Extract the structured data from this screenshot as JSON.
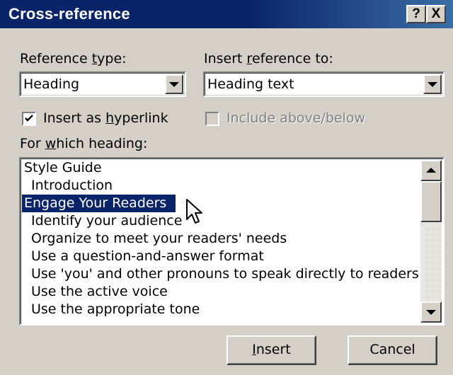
{
  "window": {
    "title": "Cross-reference",
    "help_label": "?",
    "close_label": "X"
  },
  "reference_type": {
    "label_before": "Reference ",
    "label_accel": "t",
    "label_after": "ype:",
    "value": "Heading"
  },
  "insert_reference": {
    "label_before": "Insert ",
    "label_accel": "r",
    "label_after": "eference to:",
    "value": "Heading text"
  },
  "hyperlink": {
    "label_before": "Insert as ",
    "label_accel": "h",
    "label_after": "yperlink",
    "checked": true
  },
  "above_below": {
    "label": "Include above/below",
    "enabled": false
  },
  "which_heading": {
    "label_before": "For ",
    "label_accel": "w",
    "label_after": "hich heading:"
  },
  "headings": [
    {
      "text": "Style Guide",
      "level": 1,
      "selected": false
    },
    {
      "text": "Introduction",
      "level": 2,
      "selected": false
    },
    {
      "text": "Engage Your Readers",
      "level": 1,
      "selected": true
    },
    {
      "text": "Identify your audience",
      "level": 2,
      "selected": false
    },
    {
      "text": "Organize to meet your readers' needs",
      "level": 2,
      "selected": false
    },
    {
      "text": "Use a question-and-answer format",
      "level": 2,
      "selected": false
    },
    {
      "text": "Use 'you' and other pronouns to speak directly to readers",
      "level": 2,
      "selected": false
    },
    {
      "text": "Use the active voice",
      "level": 2,
      "selected": false
    },
    {
      "text": "Use the appropriate tone",
      "level": 2,
      "selected": false
    }
  ],
  "buttons": {
    "insert": {
      "accel": "I",
      "rest": "nsert"
    },
    "cancel": "Cancel"
  },
  "colors": {
    "selection": "#0a246a",
    "face": "#d4d0c8",
    "disabled_text": "#808080"
  }
}
